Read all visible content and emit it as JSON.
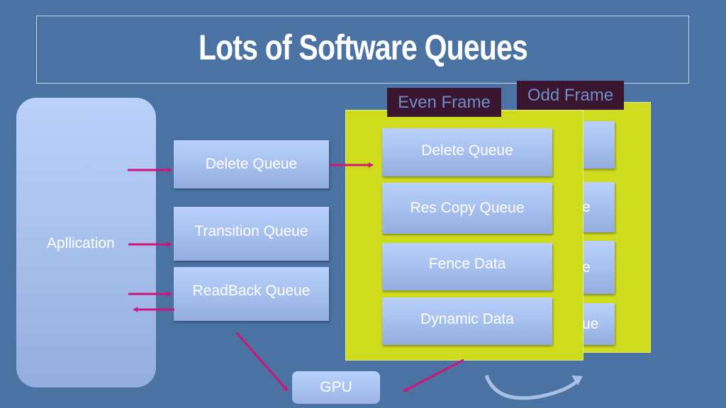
{
  "title": "Lots of Software Queues",
  "application": {
    "label": "Apllication"
  },
  "left_queues": [
    {
      "label": "Delete Queue"
    },
    {
      "label": "Transition Queue"
    },
    {
      "label": "ReadBack Queue"
    }
  ],
  "even_frame": {
    "tag": "Even Frame",
    "queues": [
      {
        "label": "Delete Queue"
      },
      {
        "label": "Res Copy Queue"
      },
      {
        "label": "Fence Data"
      },
      {
        "label": "Dynamic Data"
      }
    ]
  },
  "odd_frame": {
    "tag": "Odd Frame",
    "visible_fragments": [
      "",
      "e",
      "e",
      "ue"
    ]
  },
  "gpu": {
    "label": "GPU"
  },
  "colors": {
    "background": "#4a73a3",
    "frame_fill": "#cfdc1e",
    "frame_tag_bg": "#3a1530",
    "arrow": "#d0157a",
    "box_fill": "#a9c2f0"
  }
}
